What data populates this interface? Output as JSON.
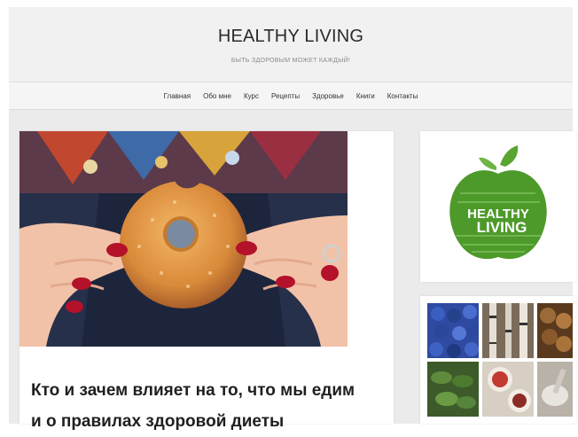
{
  "header": {
    "site_title": "HEALTHY LIVING",
    "tagline": "БЫТЬ ЗДОРОВЫМ МОЖЕТ КАЖДЫЙ!"
  },
  "nav": {
    "items": [
      "Главная",
      "Обо мне",
      "Курс",
      "Рецепты",
      "Здоровье",
      "Книги",
      "Контакты"
    ]
  },
  "post": {
    "title_line1": "Кто и зачем влияет на то, что мы едим",
    "title_line2": "и о правилах здоровой диеты"
  },
  "sidebar": {
    "logo_line1": "HEALTHY",
    "logo_line2": "LIVING"
  },
  "colors": {
    "nail_polish": "#b3122a",
    "apple_green": "#4d9a2a",
    "page_bg": "#ebebeb"
  }
}
